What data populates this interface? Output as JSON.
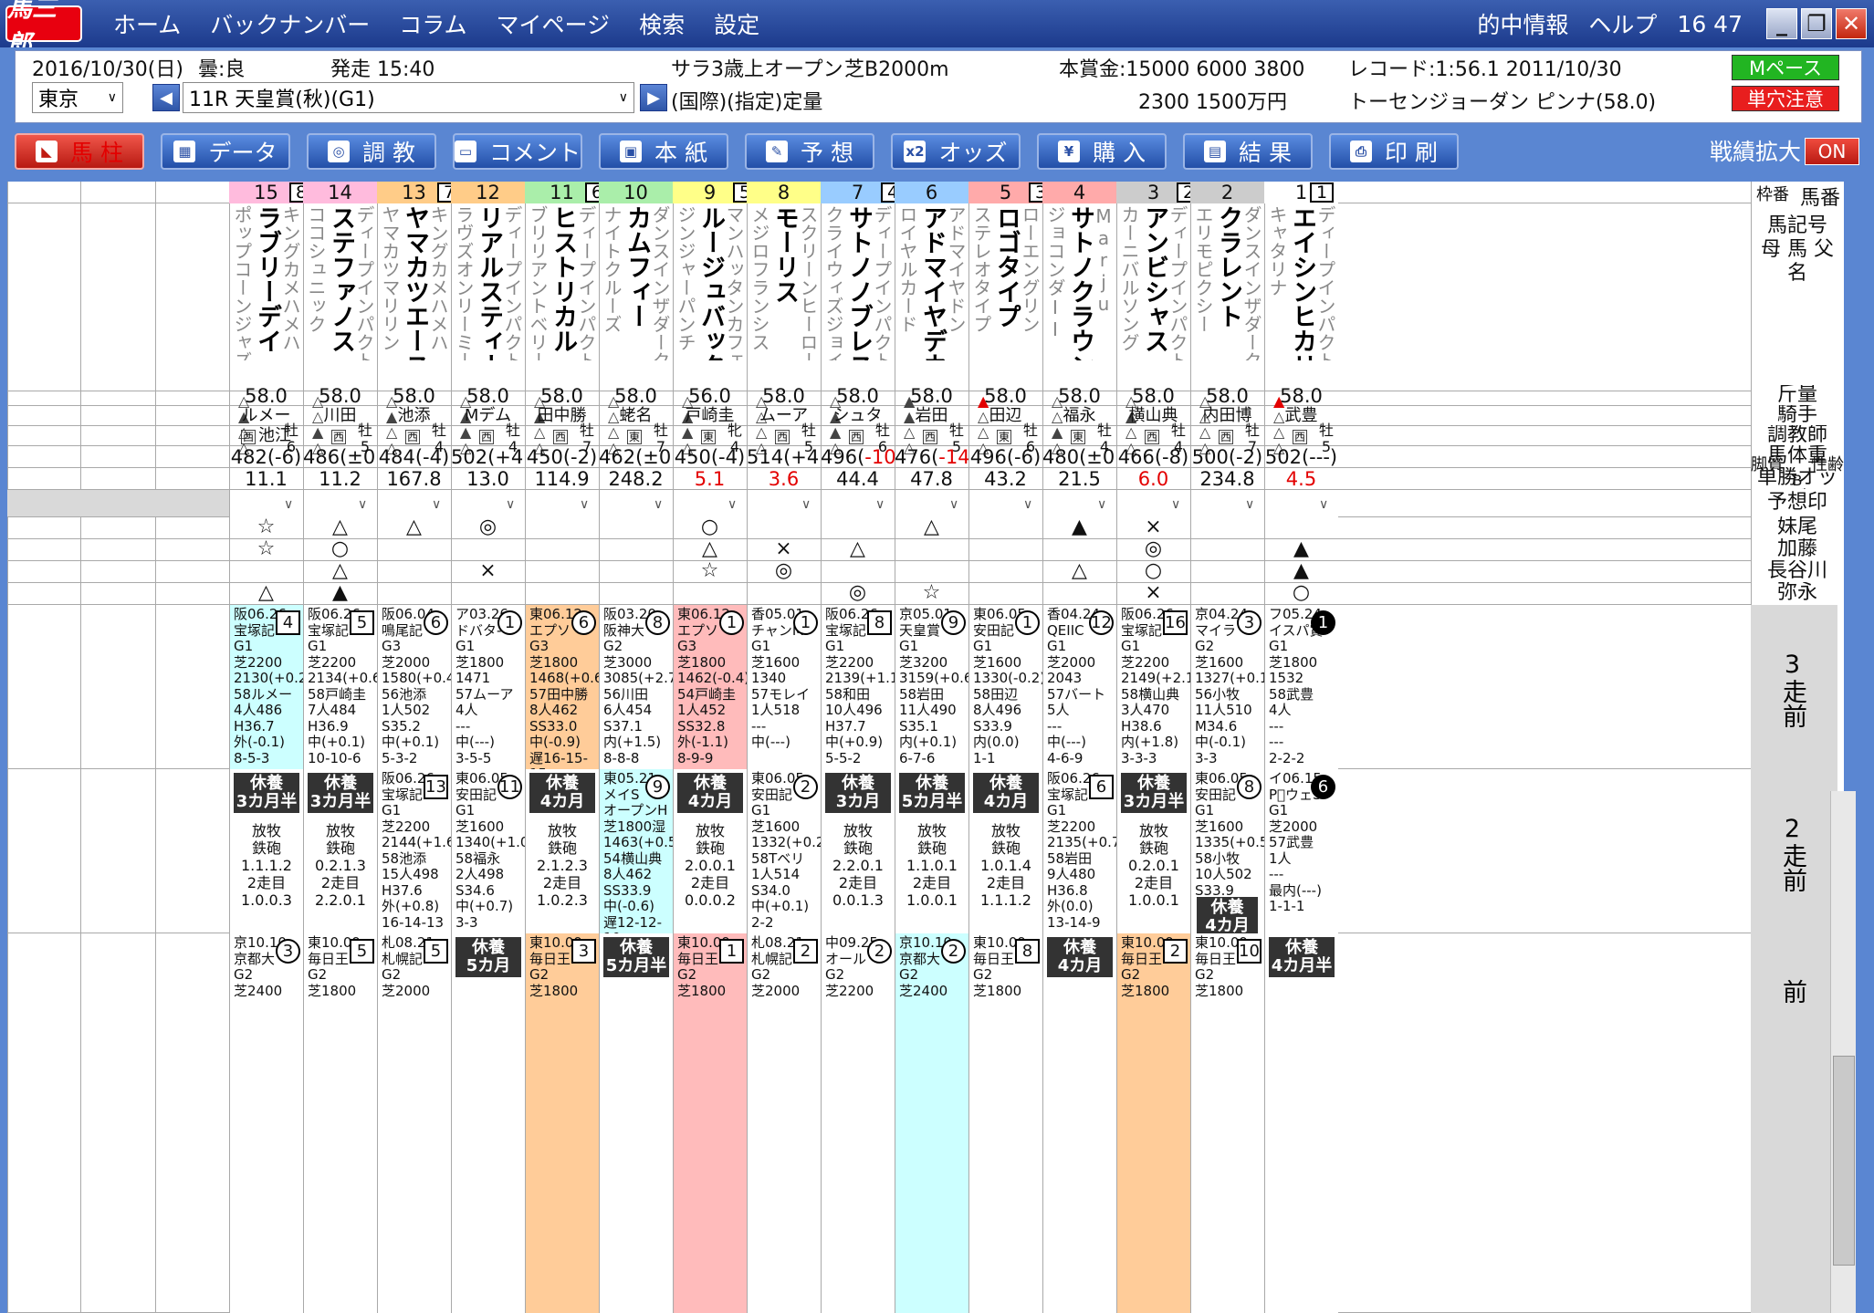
{
  "app": {
    "logo": "馬三郎",
    "menu": [
      "ホーム",
      "バックナンバー",
      "コラム",
      "マイページ",
      "検索",
      "設定"
    ],
    "right": [
      "的中情報",
      "ヘルプ",
      "16 47"
    ],
    "win": [
      "_",
      "❐",
      "✕"
    ]
  },
  "info": {
    "date": "2016/10/30(日)",
    "weather": "曇:良",
    "post": "発走 15:40",
    "class": "サラ3歳上オープン",
    "course": "芝B2000m",
    "cond": "(国際)(指定)定量",
    "prize1": "本賞金:15000 6000 3800",
    "prize2": "2300 1500万円",
    "record1": "レコード:1:56.1 2011/10/30",
    "record2": "トーセンジョーダン ピンナ(58.0)",
    "venue": "東京",
    "race": "11R 天皇賞(秋)(G1)",
    "pace": "Mペース",
    "caution": "単穴注意"
  },
  "toolbar": {
    "buttons": [
      {
        "label": "馬 柱",
        "icon": "horse-icon"
      },
      {
        "label": "データ",
        "icon": "chart-icon"
      },
      {
        "label": "調 教",
        "icon": "training-icon"
      },
      {
        "label": "コメント",
        "icon": "comment-icon"
      },
      {
        "label": "本 紙",
        "icon": "newspaper-icon"
      },
      {
        "label": "予 想",
        "icon": "pen-icon"
      },
      {
        "label": "オッズ",
        "icon": "odds-icon"
      },
      {
        "label": "購 入",
        "icon": "yen-icon"
      },
      {
        "label": "結 果",
        "icon": "result-icon"
      },
      {
        "label": "印 刷",
        "icon": "printer-icon"
      }
    ],
    "zoom_label": "戦績拡大",
    "zoom_toggle": "ON"
  },
  "row_labels": [
    "枠番",
    "馬番",
    "馬記号",
    "母 馬 父",
    "名",
    "脚質",
    "B",
    "性齢",
    "斤量",
    "騎手",
    "調教師",
    "馬体重",
    "単勝オッズ",
    "予想印",
    "妹尾",
    "加藤",
    "長谷川",
    "弥永",
    "3走前",
    "2走前",
    "前"
  ],
  "colors": {
    "waku1": "#ffffff",
    "waku2": "#cccccc",
    "waku3": "#ffaaaa",
    "waku4": "#99ccff",
    "waku5": "#ffff88",
    "waku6": "#aaeeaa",
    "waku7": "#ffcc88",
    "waku8": "#ffbbdd"
  },
  "horses": [
    {
      "num": "15",
      "waku": "8",
      "name": "ラブリーデイ",
      "sire": "キングカメハメハ",
      "dam": "ポップコーンジャズ",
      "legs": "△▲△△",
      "sex": "牡6",
      "kin": "58.0",
      "jockey": "ルメー",
      "trainer": "池江",
      "tr_region": "西",
      "weight": "482(-6)",
      "odds": "11.1",
      "mk": [
        "☆",
        "☆",
        "",
        "△"
      ],
      "r3": [
        "阪06.26",
        "宝塚記",
        "4",
        "box",
        "G1",
        "芝2200",
        "2130(+0.2)",
        "58ルメー",
        "4人486",
        "H36.7",
        "外(-0.1)",
        "8-5-3"
      ],
      "r3c": "#ccffff",
      "r2": {
        "rest": [
          "休養",
          "3カ月半"
        ],
        "lines": [
          "放牧",
          "",
          "鉄砲",
          "1.1.1.2",
          "2走目",
          "1.0.0.3"
        ]
      },
      "r1": [
        "京10.10",
        "京都大",
        "3",
        "circle",
        "G2",
        "芝2400"
      ]
    },
    {
      "num": "14",
      "waku": "8",
      "name": "ステファノス",
      "sire": "ディープインパクト",
      "dam": "ココシュニック",
      "legs": "△△▲△",
      "sex": "牡5",
      "kin": "58.0",
      "jockey": "川田",
      "tr_region": "西",
      "weight": "486(±0)",
      "odds": "11.2",
      "mk": [
        "△",
        "○",
        "△",
        "▲"
      ],
      "r3": [
        "阪06.26",
        "宝塚記",
        "5",
        "box",
        "G1",
        "芝2200",
        "2134(+0.6)",
        "58戸崎圭",
        "7人484",
        "H36.9",
        "中(+0.1)",
        "10-10-6"
      ],
      "r3c": "#ffffff",
      "r2": {
        "rest": [
          "休養",
          "3カ月半"
        ],
        "lines": [
          "放牧",
          "",
          "鉄砲",
          "0.2.1.3",
          "2走目",
          "2.2.0.1"
        ]
      },
      "r1": [
        "東10.09",
        "毎日王",
        "5",
        "box",
        "G2",
        "芝1800"
      ]
    },
    {
      "num": "13",
      "waku": "7",
      "name": "ヤマカツエース",
      "sire": "キングカメハメハ",
      "dam": "ヤマカツマリリン",
      "legs": "△▲△△",
      "sex": "牡4",
      "kin": "58.0",
      "jockey": "池添",
      "tr_region": "西",
      "weight": "484(-4)",
      "odds": "167.8",
      "mk": [
        "△",
        "",
        "",
        ""
      ],
      "r3": [
        "阪06.04",
        "鳴尾記",
        "6",
        "circle",
        "G3",
        "芝2000",
        "1580(+0.4)",
        "56池添",
        "1人502",
        "S35.2",
        "中(+0.1)",
        "5-3-2"
      ],
      "r3c": "#ffffff",
      "r2": {
        "race": [
          "阪06.26",
          "宝塚記",
          "13",
          "box",
          "G1",
          "芝2200",
          "2144(+1.6)",
          "58池添",
          "15人498",
          "H37.6",
          "外(+0.8)",
          "16-14-13"
        ]
      },
      "r1": [
        "札08.21",
        "札幌記",
        "5",
        "box",
        "G2",
        "芝2000"
      ]
    },
    {
      "num": "12",
      "waku": "7",
      "name": "リアルスティール",
      "sire": "ディープインパクト",
      "dam": "ラヴズオンリーミー",
      "legs": "△▲▲△",
      "sex": "牡4",
      "kin": "58.0",
      "jockey": "Mデム",
      "tr_region": "西",
      "weight": "502(+4)",
      "odds": "13.0",
      "mk": [
        "◎",
        "",
        "×",
        ""
      ],
      "r3": [
        "ア03.26",
        "ドバタ-",
        "1",
        "circle",
        "G1",
        "芝1800",
        "1471",
        "57ムーア",
        "4人",
        "---",
        "中(---)",
        "3-5-5"
      ],
      "r3c": "#ffffff",
      "r2": {
        "race": [
          "東06.05",
          "安田記",
          "11",
          "circle",
          "G1",
          "芝1600",
          "1340(+1.0)",
          "58福永",
          "2人498",
          "S34.6",
          "中(+0.7)",
          "3-3"
        ]
      },
      "r1rest": [
        "休養",
        "5カ月"
      ]
    },
    {
      "num": "11",
      "waku": "6",
      "name": "ヒストリカル",
      "sire": "ディープインパクト",
      "dam": "ブリリアントベリー",
      "legs": "△▲△△",
      "sex": "牡7",
      "kin": "58.0",
      "jockey": "田中勝",
      "tr_region": "西",
      "weight": "450(-2)",
      "odds": "114.9",
      "mk": [
        "",
        "",
        "",
        ""
      ],
      "r3": [
        "東06.12",
        "エプソ",
        "6",
        "circle",
        "G3",
        "芝1800",
        "1468(+0.6)",
        "57田中勝",
        "8人462",
        "SS33.0",
        "中(-0.9)",
        "遅16-15-15"
      ],
      "r3c": "#ffcc99",
      "r2": {
        "rest": [
          "休養",
          "4カ月"
        ],
        "lines": [
          "放牧",
          "",
          "鉄砲",
          "2.1.2.3",
          "2走目",
          "1.0.2.3"
        ]
      },
      "r1": [
        "東10.09",
        "毎日王",
        "3",
        "box",
        "G2",
        "芝1800"
      ],
      "r1c": "#ffcc99"
    },
    {
      "num": "10",
      "waku": "6",
      "name": "カムフィー",
      "sire": "ダンスインザダーク",
      "dam": "ナイトクルーズ",
      "legs": "△△△△",
      "sex": "牡7",
      "kin": "58.0",
      "jockey": "蛯名",
      "tr_region": "東",
      "weight": "462(±0)",
      "odds": "248.2",
      "mk": [
        "",
        "",
        "",
        ""
      ],
      "r3": [
        "阪03.20",
        "阪神大",
        "8",
        "circle",
        "G2",
        "芝3000",
        "3085(+2.7)",
        "56川田",
        "6人454",
        "S37.1",
        "内(+1.5)",
        "8-8-8"
      ],
      "r3c": "#ffffff",
      "r2": {
        "race": [
          "東05.21",
          "メイS",
          "9",
          "circle",
          "オープンH",
          "芝1800湿",
          "1463(+0.5)",
          "54横山典",
          "8人462",
          "SS33.9",
          "中(-0.6)",
          "遅12-12-10"
        ]
      },
      "r2c": "#ccffff",
      "r1rest": [
        "休養",
        "5カ月半"
      ]
    },
    {
      "num": "9",
      "waku": "5",
      "name": "ルージュバック",
      "sire": "マンハッタンカフェ",
      "dam": "ジンジャーパンチ",
      "legs": "△▲▲△",
      "sex": "牝4",
      "kin": "56.0",
      "jockey": "戸崎圭",
      "tr_region": "東",
      "weight": "450(-4)",
      "odds": "5.1",
      "oddsRed": true,
      "mk": [
        "○",
        "△",
        "☆",
        ""
      ],
      "r3": [
        "東06.12",
        "エプソ",
        "1",
        "circle",
        "G3",
        "芝1800",
        "1462(-0.4)",
        "54戸崎圭",
        "1人452",
        "SS32.8",
        "外(-1.1)",
        "8-9-9"
      ],
      "r3c": "#ffbbbb",
      "r2": {
        "rest": [
          "休養",
          "4カ月"
        ],
        "lines": [
          "放牧",
          "",
          "鉄砲",
          "2.0.0.1",
          "2走目",
          "0.0.0.2"
        ]
      },
      "r1": [
        "東10.09",
        "毎日王",
        "1",
        "box",
        "G2",
        "芝1800"
      ],
      "r1c": "#ffbbbb"
    },
    {
      "num": "8",
      "waku": "5",
      "name": "モーリス",
      "sire": "スクリーンヒーロー",
      "dam": "メジロフランシス",
      "legs": "△△△△",
      "sex": "牡5",
      "kin": "58.0",
      "jockey": "ムーア",
      "tr_region": "西",
      "weight": "514(+4)",
      "odds": "3.6",
      "oddsRed": true,
      "mk": [
        "",
        "×",
        "◎",
        ""
      ],
      "r3": [
        "香05.01",
        "チャンM",
        "1",
        "circle",
        "G1",
        "芝1600",
        "1340",
        "57モレイ",
        "1人518",
        "---",
        "中(---)",
        ""
      ],
      "r3c": "#ffffff",
      "r2": {
        "race": [
          "東06.05",
          "安田記",
          "2",
          "circle",
          "G1",
          "芝1600",
          "1332(+0.2)",
          "58Tベリ",
          "1人514",
          "S34.0",
          "中(+0.1)",
          "2-2"
        ]
      },
      "r1": [
        "札08.21",
        "札幌記",
        "2",
        "box",
        "G2",
        "芝2000"
      ]
    },
    {
      "num": "7",
      "waku": "4",
      "name": "サトノノブレス",
      "sire": "ディープインパクト",
      "dam": "クライウィズジョイ",
      "legs": "△▲▲△",
      "sex": "牡6",
      "kin": "58.0",
      "jockey": "シュタ",
      "tr_region": "西",
      "weight": "496(-10)",
      "weightRed": "-10",
      "odds": "44.4",
      "mk": [
        "",
        "△",
        "",
        "◎"
      ],
      "r3": [
        "阪06.26",
        "宝塚記",
        "8",
        "box",
        "G1",
        "芝2200",
        "2139(+1.1)",
        "58和田",
        "10人496",
        "H37.7",
        "中(+0.9)",
        "5-5-2"
      ],
      "r3c": "#ffffff",
      "r2": {
        "rest": [
          "休養",
          "3カ月"
        ],
        "lines": [
          "放牧",
          "",
          "鉄砲",
          "2.2.0.1",
          "2走目",
          "0.0.1.3"
        ]
      },
      "r1": [
        "中09.25",
        "オール",
        "2",
        "circle",
        "G2",
        "芝2200"
      ]
    },
    {
      "num": "6",
      "waku": "4",
      "name": "アドマイヤデウス",
      "sire": "アドマイヤドン",
      "dam": "ロイヤルカード",
      "legs": "▲▲△△",
      "sex": "牡5",
      "kin": "58.0",
      "jockey": "岩田",
      "tr_region": "西",
      "weight": "476(-14)",
      "weightRed": "-14",
      "odds": "47.8",
      "mk": [
        "△",
        "",
        "",
        "☆"
      ],
      "r3": [
        "京05.01",
        "天皇賞",
        "9",
        "circle",
        "G1",
        "芝3200",
        "3159(+0.6)",
        "58岩田",
        "11人490",
        "S35.1",
        "内(+0.1)",
        "6-7-6"
      ],
      "r3c": "#ffffff",
      "r2": {
        "rest": [
          "休養",
          "5カ月半"
        ],
        "lines": [
          "放牧",
          "",
          "鉄砲",
          "1.1.0.1",
          "2走目",
          "1.0.0.1"
        ]
      },
      "r1": [
        "京10.10",
        "京都大",
        "2",
        "circle",
        "G2",
        "芝2400"
      ],
      "r1c": "#ccffff"
    },
    {
      "num": "5",
      "waku": "3",
      "name": "ロゴタイプ",
      "sire": "ローエングリン",
      "dam": "ステレオタイプ",
      "legs": "▲△△△",
      "sex": "牡6",
      "kin": "58.0",
      "jockey": "田辺",
      "tr_region": "東",
      "weight": "496(-6)",
      "odds": "43.2",
      "mk": [
        "",
        "",
        "",
        ""
      ],
      "r3": [
        "東06.05",
        "安田記",
        "1",
        "circle",
        "G1",
        "芝1600",
        "1330(-0.2)",
        "58田辺",
        "8人496",
        "S33.9",
        "内(0.0)",
        "1-1"
      ],
      "r3c": "#ffffff",
      "r2": {
        "rest": [
          "休養",
          "4カ月"
        ],
        "lines": [
          "放牧",
          "",
          "鉄砲",
          "1.0.1.4",
          "2走目",
          "1.1.1.2"
        ]
      },
      "r1": [
        "東10.09",
        "毎日王",
        "8",
        "box",
        "G2",
        "芝1800"
      ]
    },
    {
      "num": "4",
      "waku": "3",
      "name": "サトノクラウン",
      "sire": "Marju",
      "dam": "ジョコンダII",
      "legs": "△△▲△",
      "sex": "牡4",
      "kin": "58.0",
      "jockey": "福永",
      "tr_region": "東",
      "weight": "480(±0)",
      "odds": "21.5",
      "mk": [
        "▲",
        "",
        "△",
        ""
      ],
      "r3": [
        "香04.24",
        "QEIIC",
        "12",
        "circle",
        "G1",
        "芝2000",
        "2043",
        "57バート",
        "5人",
        "---",
        "中(---)",
        "4-6-9"
      ],
      "r3c": "#ffffff",
      "r2": {
        "race": [
          "阪06.26",
          "宝塚記",
          "6",
          "box",
          "G1",
          "芝2200",
          "2135(+0.7)",
          "58岩田",
          "9人480",
          "H36.8",
          "外(0.0)",
          "13-14-9"
        ]
      },
      "r1rest": [
        "休養",
        "4カ月"
      ]
    },
    {
      "num": "3",
      "waku": "2",
      "name": "アンビシャス",
      "sire": "ディープインパクト",
      "dam": "カーニバルソング",
      "legs": "△▲△△",
      "sex": "牡4",
      "kin": "58.0",
      "jockey": "横山典",
      "tr_region": "西",
      "weight": "466(-8)",
      "odds": "6.0",
      "oddsRed": true,
      "mk": [
        "×",
        "◎",
        "○",
        "×"
      ],
      "r3": [
        "阪06.26",
        "宝塚記",
        "16",
        "box",
        "G1",
        "芝2200",
        "2149(+2.1)",
        "58横山典",
        "3人470",
        "H38.6",
        "内(+1.8)",
        "3-3-3"
      ],
      "r3c": "#ffffff",
      "r2": {
        "rest": [
          "休養",
          "3カ月半"
        ],
        "lines": [
          "放牧",
          "",
          "鉄砲",
          "0.2.0.1",
          "2走目",
          "1.0.0.1"
        ]
      },
      "r1": [
        "東10.09",
        "毎日王",
        "2",
        "box",
        "G2",
        "芝1800"
      ],
      "r1c": "#ffcc99"
    },
    {
      "num": "2",
      "waku": "2",
      "name": "クラレント",
      "sire": "ダンスインザダーク",
      "dam": "エリモピクシー",
      "legs": "△△△△",
      "sex": "牡7",
      "kin": "58.0",
      "jockey": "内田博",
      "tr_region": "西",
      "weight": "500(-2)",
      "odds": "234.8",
      "mk": [
        "",
        "",
        "",
        ""
      ],
      "r3": [
        "京04.24",
        "マイラ",
        "3",
        "circle",
        "G2",
        "芝1600",
        "1327(+0.1)",
        "56小牧",
        "11人510",
        "M34.6",
        "中(-0.1)",
        "3-3"
      ],
      "r3c": "#ffffff",
      "r2": {
        "race": [
          "東06.05",
          "安田記",
          "8",
          "circle",
          "G1",
          "芝1600",
          "1335(+0.5)",
          "58小牧",
          "10人502",
          "S33.9",
          ""
        ]
      },
      "r2rest": [
        "休養",
        "4カ月"
      ],
      "r1": [
        "東10.09",
        "毎日王",
        "10",
        "box",
        "G2",
        "芝1800"
      ]
    },
    {
      "num": "1",
      "waku": "1",
      "name": "エイシンヒカリ",
      "sire": "ディープインパクト",
      "dam": "キャタリナ",
      "legs": "▲△△△",
      "sex": "牡5",
      "kin": "58.0",
      "jockey": "武豊",
      "tr_region": "西",
      "weight": "502(---)",
      "odds": "4.5",
      "oddsRed": true,
      "mk": [
        "",
        "▲",
        "▲",
        "○"
      ],
      "r3": [
        "フ05.24",
        "イスパ賞",
        "1",
        "inv",
        "G1",
        "芝1800",
        "1532",
        "58武豊",
        "4人",
        "---",
        "---",
        "2-2-2"
      ],
      "r3c": "#ffffff",
      "r2": {
        "race": [
          "イ06.15",
          "P゚ウェS",
          "6",
          "inv",
          "G1",
          "芝2000",
          "",
          "57武豊",
          "1人",
          "---",
          "最内(---)",
          "1-1-1"
        ]
      },
      "r1rest": [
        "休養",
        "4カ月半"
      ]
    }
  ]
}
